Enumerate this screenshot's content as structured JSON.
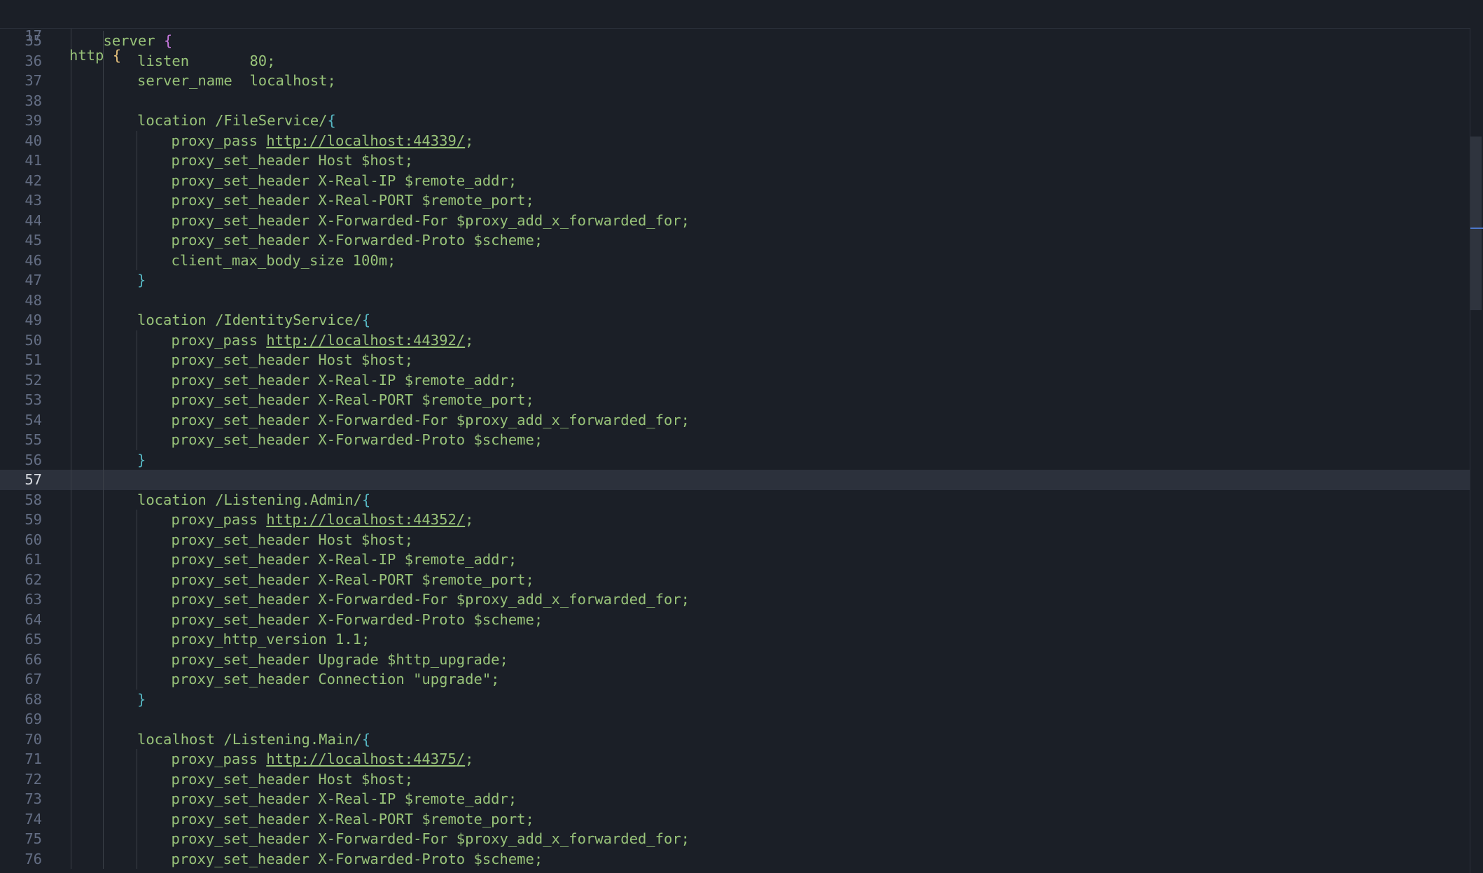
{
  "sticky_header": {
    "line_number": "17",
    "keyword": "http",
    "brace": "{"
  },
  "lines": [
    {
      "n": "35",
      "indent": 1,
      "tokens": [
        [
          "kw",
          "server"
        ],
        [
          "plain",
          " "
        ],
        [
          "br2",
          "{"
        ]
      ]
    },
    {
      "n": "36",
      "indent": 2,
      "tokens": [
        [
          "kw",
          "listen       80;"
        ]
      ]
    },
    {
      "n": "37",
      "indent": 2,
      "tokens": [
        [
          "kw",
          "server_name  localhost;"
        ]
      ]
    },
    {
      "n": "38",
      "indent": 0,
      "tokens": []
    },
    {
      "n": "39",
      "indent": 2,
      "tokens": [
        [
          "kw",
          "location /FileService/"
        ],
        [
          "br3",
          "{"
        ]
      ]
    },
    {
      "n": "40",
      "indent": 3,
      "tokens": [
        [
          "kw",
          "proxy_pass "
        ],
        [
          "url",
          "http://localhost:44339/"
        ],
        [
          "kw",
          ";"
        ]
      ]
    },
    {
      "n": "41",
      "indent": 3,
      "tokens": [
        [
          "kw",
          "proxy_set_header Host $host;"
        ]
      ]
    },
    {
      "n": "42",
      "indent": 3,
      "tokens": [
        [
          "kw",
          "proxy_set_header X-Real-IP $remote_addr;"
        ]
      ]
    },
    {
      "n": "43",
      "indent": 3,
      "tokens": [
        [
          "kw",
          "proxy_set_header X-Real-PORT $remote_port;"
        ]
      ]
    },
    {
      "n": "44",
      "indent": 3,
      "tokens": [
        [
          "kw",
          "proxy_set_header X-Forwarded-For $proxy_add_x_forwarded_for;"
        ]
      ]
    },
    {
      "n": "45",
      "indent": 3,
      "tokens": [
        [
          "kw",
          "proxy_set_header X-Forwarded-Proto $scheme;"
        ]
      ]
    },
    {
      "n": "46",
      "indent": 3,
      "tokens": [
        [
          "kw",
          "client_max_body_size 100m;"
        ]
      ]
    },
    {
      "n": "47",
      "indent": 2,
      "tokens": [
        [
          "br3",
          "}"
        ]
      ]
    },
    {
      "n": "48",
      "indent": 0,
      "tokens": []
    },
    {
      "n": "49",
      "indent": 2,
      "tokens": [
        [
          "kw",
          "location /IdentityService/"
        ],
        [
          "br3",
          "{"
        ]
      ]
    },
    {
      "n": "50",
      "indent": 3,
      "tokens": [
        [
          "kw",
          "proxy_pass "
        ],
        [
          "url",
          "http://localhost:44392/"
        ],
        [
          "kw",
          ";"
        ]
      ]
    },
    {
      "n": "51",
      "indent": 3,
      "tokens": [
        [
          "kw",
          "proxy_set_header Host $host;"
        ]
      ]
    },
    {
      "n": "52",
      "indent": 3,
      "tokens": [
        [
          "kw",
          "proxy_set_header X-Real-IP $remote_addr;"
        ]
      ]
    },
    {
      "n": "53",
      "indent": 3,
      "tokens": [
        [
          "kw",
          "proxy_set_header X-Real-PORT $remote_port;"
        ]
      ]
    },
    {
      "n": "54",
      "indent": 3,
      "tokens": [
        [
          "kw",
          "proxy_set_header X-Forwarded-For $proxy_add_x_forwarded_for;"
        ]
      ]
    },
    {
      "n": "55",
      "indent": 3,
      "tokens": [
        [
          "kw",
          "proxy_set_header X-Forwarded-Proto $scheme;"
        ]
      ]
    },
    {
      "n": "56",
      "indent": 2,
      "tokens": [
        [
          "br3",
          "}"
        ]
      ]
    },
    {
      "n": "57",
      "indent": 0,
      "tokens": [],
      "current": true
    },
    {
      "n": "58",
      "indent": 2,
      "tokens": [
        [
          "kw",
          "location /Listening.Admin/"
        ],
        [
          "br3",
          "{"
        ]
      ]
    },
    {
      "n": "59",
      "indent": 3,
      "tokens": [
        [
          "kw",
          "proxy_pass "
        ],
        [
          "url",
          "http://localhost:44352/"
        ],
        [
          "kw",
          ";"
        ]
      ]
    },
    {
      "n": "60",
      "indent": 3,
      "tokens": [
        [
          "kw",
          "proxy_set_header Host $host;"
        ]
      ]
    },
    {
      "n": "61",
      "indent": 3,
      "tokens": [
        [
          "kw",
          "proxy_set_header X-Real-IP $remote_addr;"
        ]
      ]
    },
    {
      "n": "62",
      "indent": 3,
      "tokens": [
        [
          "kw",
          "proxy_set_header X-Real-PORT $remote_port;"
        ]
      ]
    },
    {
      "n": "63",
      "indent": 3,
      "tokens": [
        [
          "kw",
          "proxy_set_header X-Forwarded-For $proxy_add_x_forwarded_for;"
        ]
      ]
    },
    {
      "n": "64",
      "indent": 3,
      "tokens": [
        [
          "kw",
          "proxy_set_header X-Forwarded-Proto $scheme;"
        ]
      ]
    },
    {
      "n": "65",
      "indent": 3,
      "tokens": [
        [
          "kw",
          "proxy_http_version 1.1;"
        ]
      ]
    },
    {
      "n": "66",
      "indent": 3,
      "tokens": [
        [
          "kw",
          "proxy_set_header Upgrade $http_upgrade;"
        ]
      ]
    },
    {
      "n": "67",
      "indent": 3,
      "tokens": [
        [
          "kw",
          "proxy_set_header Connection \"upgrade\";"
        ]
      ]
    },
    {
      "n": "68",
      "indent": 2,
      "tokens": [
        [
          "br3",
          "}"
        ]
      ]
    },
    {
      "n": "69",
      "indent": 0,
      "tokens": []
    },
    {
      "n": "70",
      "indent": 2,
      "tokens": [
        [
          "kw",
          "localhost /Listening.Main/"
        ],
        [
          "br3",
          "{"
        ]
      ]
    },
    {
      "n": "71",
      "indent": 3,
      "tokens": [
        [
          "kw",
          "proxy_pass "
        ],
        [
          "url",
          "http://localhost:44375/"
        ],
        [
          "kw",
          ";"
        ]
      ]
    },
    {
      "n": "72",
      "indent": 3,
      "tokens": [
        [
          "kw",
          "proxy_set_header Host $host;"
        ]
      ]
    },
    {
      "n": "73",
      "indent": 3,
      "tokens": [
        [
          "kw",
          "proxy_set_header X-Real-IP $remote_addr;"
        ]
      ]
    },
    {
      "n": "74",
      "indent": 3,
      "tokens": [
        [
          "kw",
          "proxy_set_header X-Real-PORT $remote_port;"
        ]
      ]
    },
    {
      "n": "75",
      "indent": 3,
      "tokens": [
        [
          "kw",
          "proxy_set_header X-Forwarded-For $proxy_add_x_forwarded_for;"
        ]
      ]
    },
    {
      "n": "76",
      "indent": 3,
      "tokens": [
        [
          "kw",
          "proxy_set_header X-Forwarded-Proto $scheme;"
        ]
      ]
    }
  ],
  "colors": {
    "background": "#1b1f27",
    "directive": "#98c379",
    "line_number": "#636d83",
    "brace_level1": "#e5c07b",
    "brace_level2": "#c678dd",
    "brace_level3": "#56b6c2",
    "current_line": "#2c313c"
  }
}
